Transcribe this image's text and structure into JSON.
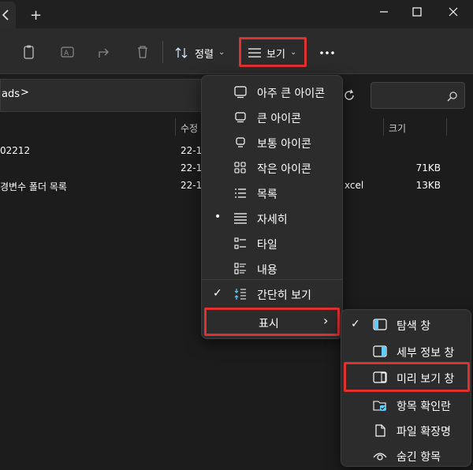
{
  "window": {
    "tab_close_icon": "close-icon",
    "new_tab_symbol": "+",
    "controls": [
      "minimize-icon",
      "maximize-icon",
      "close-icon"
    ]
  },
  "toolbar": {
    "actions": [
      "copy-icon",
      "rename-icon",
      "share-icon",
      "delete-icon"
    ],
    "sort_label": "정렬",
    "view_label": "보기",
    "more_icon": "more-icon"
  },
  "address": {
    "path_tail": "ads",
    "separator": ">"
  },
  "file_list": {
    "headers": {
      "modified": "수정",
      "size": "크기"
    },
    "rows": [
      {
        "name": "02212",
        "date": "22-1",
        "type": "",
        "size": ""
      },
      {
        "name": "",
        "date": "22-1",
        "type": "",
        "size": "71KB"
      },
      {
        "name": "경변수 폴더 목록",
        "date": "22-1",
        "type": "xcel",
        "size": "13KB"
      }
    ]
  },
  "view_menu": {
    "items": [
      {
        "label": "아주 큰 아이콘",
        "icon": "extra-large-icons-icon",
        "mark": ""
      },
      {
        "label": "큰 아이콘",
        "icon": "large-icons-icon",
        "mark": ""
      },
      {
        "label": "보통 아이콘",
        "icon": "medium-icons-icon",
        "mark": ""
      },
      {
        "label": "작은 아이콘",
        "icon": "small-icons-icon",
        "mark": ""
      },
      {
        "label": "목록",
        "icon": "list-icon",
        "mark": ""
      },
      {
        "label": "자세히",
        "icon": "details-icon",
        "mark": "•"
      },
      {
        "label": "타일",
        "icon": "tiles-icon",
        "mark": ""
      },
      {
        "label": "내용",
        "icon": "content-icon",
        "mark": ""
      },
      {
        "label": "간단히 보기",
        "icon": "compact-view-icon",
        "mark": "✓"
      }
    ],
    "show_label": "표시",
    "show_chevron": "›"
  },
  "show_menu": {
    "items": [
      {
        "label": "탐색 창",
        "icon": "navigation-pane-icon",
        "mark": "✓"
      },
      {
        "label": "세부 정보 창",
        "icon": "details-pane-icon",
        "mark": ""
      },
      {
        "label": "미리 보기 창",
        "icon": "preview-pane-icon",
        "mark": ""
      },
      {
        "label": "항목 확인란",
        "icon": "item-checkbox-icon",
        "mark": ""
      },
      {
        "label": "파일 확장명",
        "icon": "file-extension-icon",
        "mark": ""
      },
      {
        "label": "숨긴 항목",
        "icon": "hidden-items-icon",
        "mark": ""
      }
    ]
  },
  "colors": {
    "highlight_box": "#e03131",
    "accent": "#60cdff",
    "background": "#1c1c1c",
    "menu_background": "#2c2c2c"
  }
}
